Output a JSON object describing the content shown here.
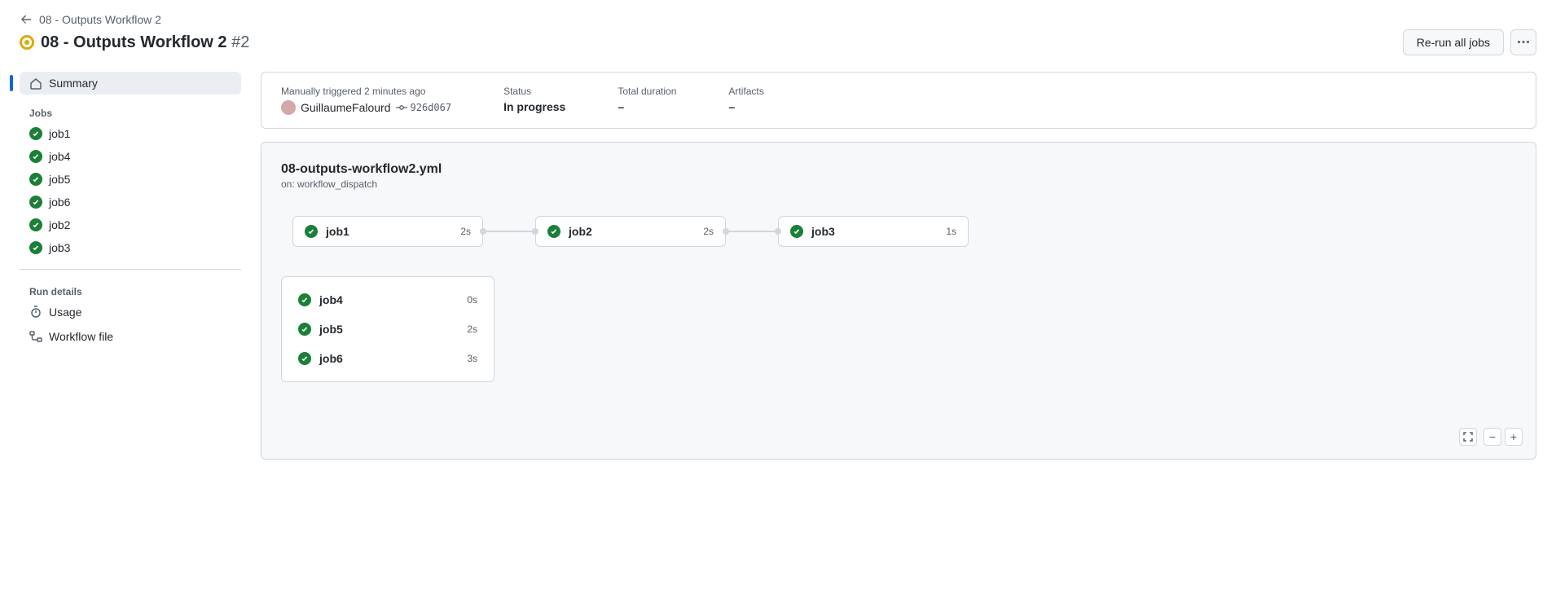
{
  "breadcrumb": {
    "back_label": "08 - Outputs Workflow 2"
  },
  "title": {
    "name": "08 - Outputs Workflow 2",
    "run_number": "#2"
  },
  "actions": {
    "rerun": "Re-run all jobs"
  },
  "sidebar": {
    "summary": "Summary",
    "jobs_header": "Jobs",
    "jobs": [
      {
        "name": "job1"
      },
      {
        "name": "job4"
      },
      {
        "name": "job5"
      },
      {
        "name": "job6"
      },
      {
        "name": "job2"
      },
      {
        "name": "job3"
      }
    ],
    "run_details_header": "Run details",
    "usage": "Usage",
    "workflow_file": "Workflow file"
  },
  "summary": {
    "trigger_line": "Manually triggered 2 minutes ago",
    "actor": "GuillaumeFalourd",
    "commit": "926d067",
    "status_label": "Status",
    "status_value": "In progress",
    "duration_label": "Total duration",
    "duration_value": "–",
    "artifacts_label": "Artifacts",
    "artifacts_value": "–"
  },
  "workflow": {
    "file": "08-outputs-workflow2.yml",
    "on": "on: workflow_dispatch"
  },
  "graph": {
    "chain": [
      {
        "name": "job1",
        "duration": "2s"
      },
      {
        "name": "job2",
        "duration": "2s"
      },
      {
        "name": "job3",
        "duration": "1s"
      }
    ],
    "group": [
      {
        "name": "job4",
        "duration": "0s"
      },
      {
        "name": "job5",
        "duration": "2s"
      },
      {
        "name": "job6",
        "duration": "3s"
      }
    ]
  },
  "colors": {
    "success": "#1a7f37",
    "running": "#dbab0a",
    "accent": "#0969da"
  }
}
